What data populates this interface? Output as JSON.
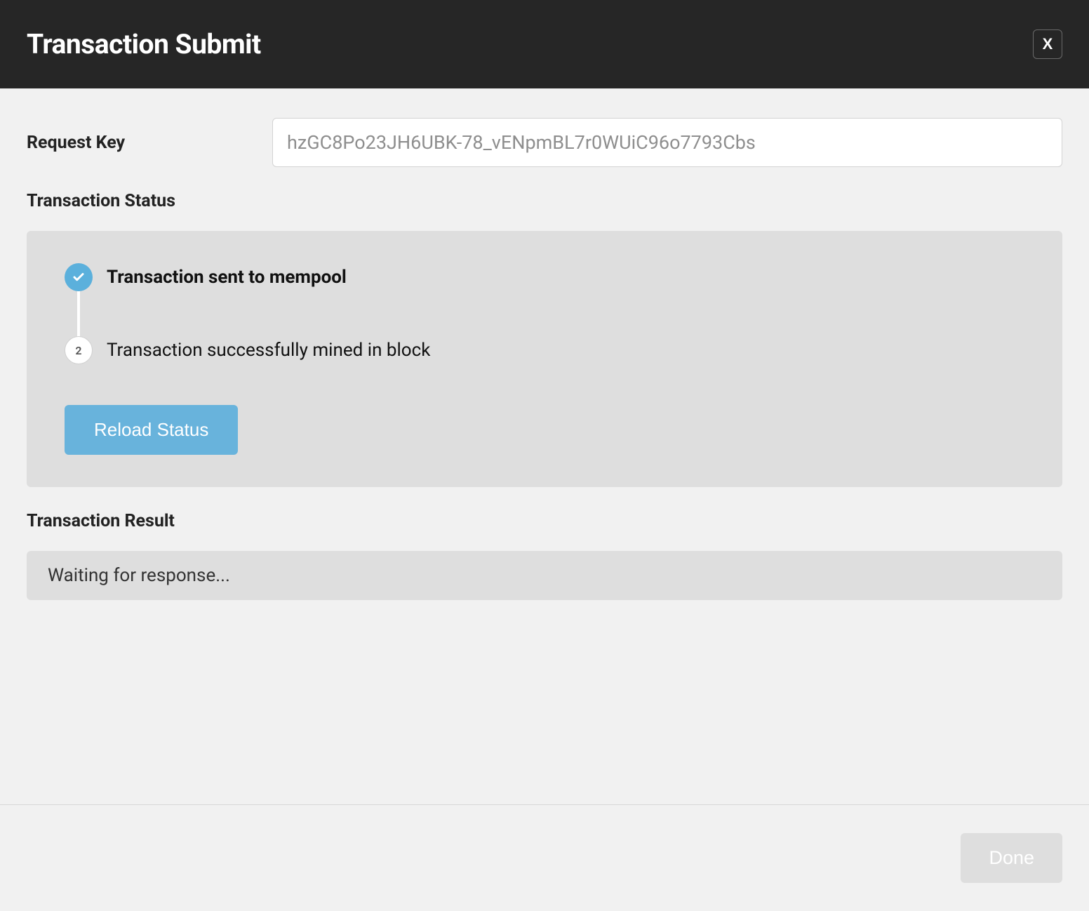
{
  "header": {
    "title": "Transaction Submit",
    "close_label": "X"
  },
  "request_key": {
    "label": "Request Key",
    "value": "hzGC8Po23JH6UBK-78_vENpmBL7r0WUiC96o7793Cbs"
  },
  "status": {
    "section_label": "Transaction Status",
    "steps": [
      {
        "state": "complete",
        "label": "Transaction sent to mempool"
      },
      {
        "state": "pending",
        "number": "2",
        "label": "Transaction successfully mined in block"
      }
    ],
    "reload_label": "Reload Status"
  },
  "result": {
    "section_label": "Transaction Result",
    "message": "Waiting for response..."
  },
  "footer": {
    "done_label": "Done"
  },
  "colors": {
    "accent_blue": "#5bb0dc",
    "header_bg": "#262626",
    "card_bg": "#dedede",
    "body_bg": "#f1f1f1"
  }
}
